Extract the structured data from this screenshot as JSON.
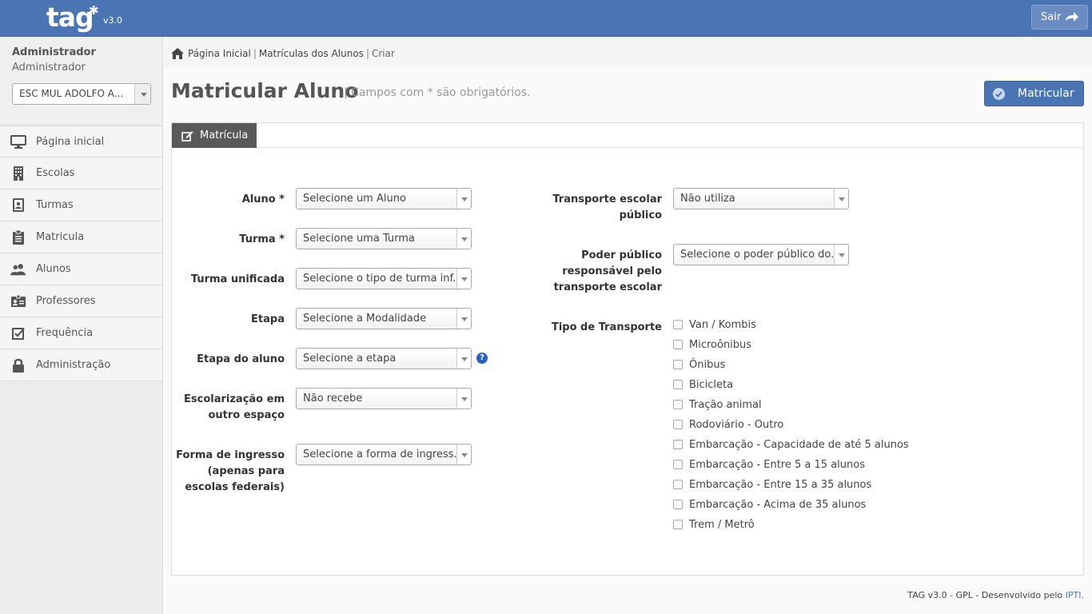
{
  "app": {
    "logo_text": "tag",
    "version": "v3.0",
    "exit_label": "Sair"
  },
  "colors": {
    "topbar": "#4a74b3",
    "primary_button": "#4a74b3",
    "tab_active": "#595959",
    "help_icon": "#2b62c0"
  },
  "sidebar": {
    "user_name": "Administrador",
    "user_role": "Administrador",
    "school_selected": "ESC MUL ADOLFO A...",
    "items": [
      {
        "label": "Página inicial",
        "icon": "monitor-icon"
      },
      {
        "label": "Escolas",
        "icon": "building-icon"
      },
      {
        "label": "Turmas",
        "icon": "contact-book-icon"
      },
      {
        "label": "Matricula",
        "icon": "clipboard-icon"
      },
      {
        "label": "Alunos",
        "icon": "users-icon"
      },
      {
        "label": "Professores",
        "icon": "id-card-icon"
      },
      {
        "label": "Frequência",
        "icon": "checkbox-icon"
      },
      {
        "label": "Administração",
        "icon": "lock-icon"
      }
    ]
  },
  "breadcrumb": {
    "home": "Página Inicial",
    "section": "Matrículas dos Alunos",
    "current": "Criar",
    "separator": "|"
  },
  "page": {
    "title": "Matricular Aluno",
    "subtitle": "| Campos com * são obrigatórios.",
    "submit_label": "Matricular"
  },
  "tabs": [
    {
      "label": "Matrícula",
      "active": true
    }
  ],
  "form_left": [
    {
      "label": "Aluno *",
      "value": "Selecione um Aluno"
    },
    {
      "label": "Turma *",
      "value": "Selecione uma Turma"
    },
    {
      "label": "Turma unificada",
      "value": "Selecione o tipo de turma inf..."
    },
    {
      "label": "Etapa",
      "value": "Selecione a Modalidade"
    },
    {
      "label": "Etapa do aluno",
      "value": "Selecione a etapa",
      "help": "?"
    },
    {
      "label": "Escolarização em outro espaço",
      "value": "Não recebe"
    },
    {
      "label": "Forma de ingresso (apenas para escolas federais)",
      "value": "Selecione a forma de ingress..."
    }
  ],
  "form_right": {
    "transport_label": "Transporte escolar público",
    "transport_value": "Não utiliza",
    "power_label": "Poder público responsável pelo transporte escolar",
    "power_value": "Selecione o poder público do...",
    "type_label": "Tipo de Transporte",
    "types": [
      "Van / Kombis",
      "Microônibus",
      "Ônibus",
      "Bicicleta",
      "Tração animal",
      "Rodoviário - Outro",
      "Embarcação - Capacidade de até 5 alunos",
      "Embarcação - Entre 5 a 15 alunos",
      "Embarcação - Entre 15 a 35 alunos",
      "Embarcação - Acima de 35 alunos",
      "Trem / Metrô"
    ]
  },
  "footer": {
    "text": "TAG v3.0 - GPL - Desenvolvido pelo",
    "link": "IPTI."
  }
}
